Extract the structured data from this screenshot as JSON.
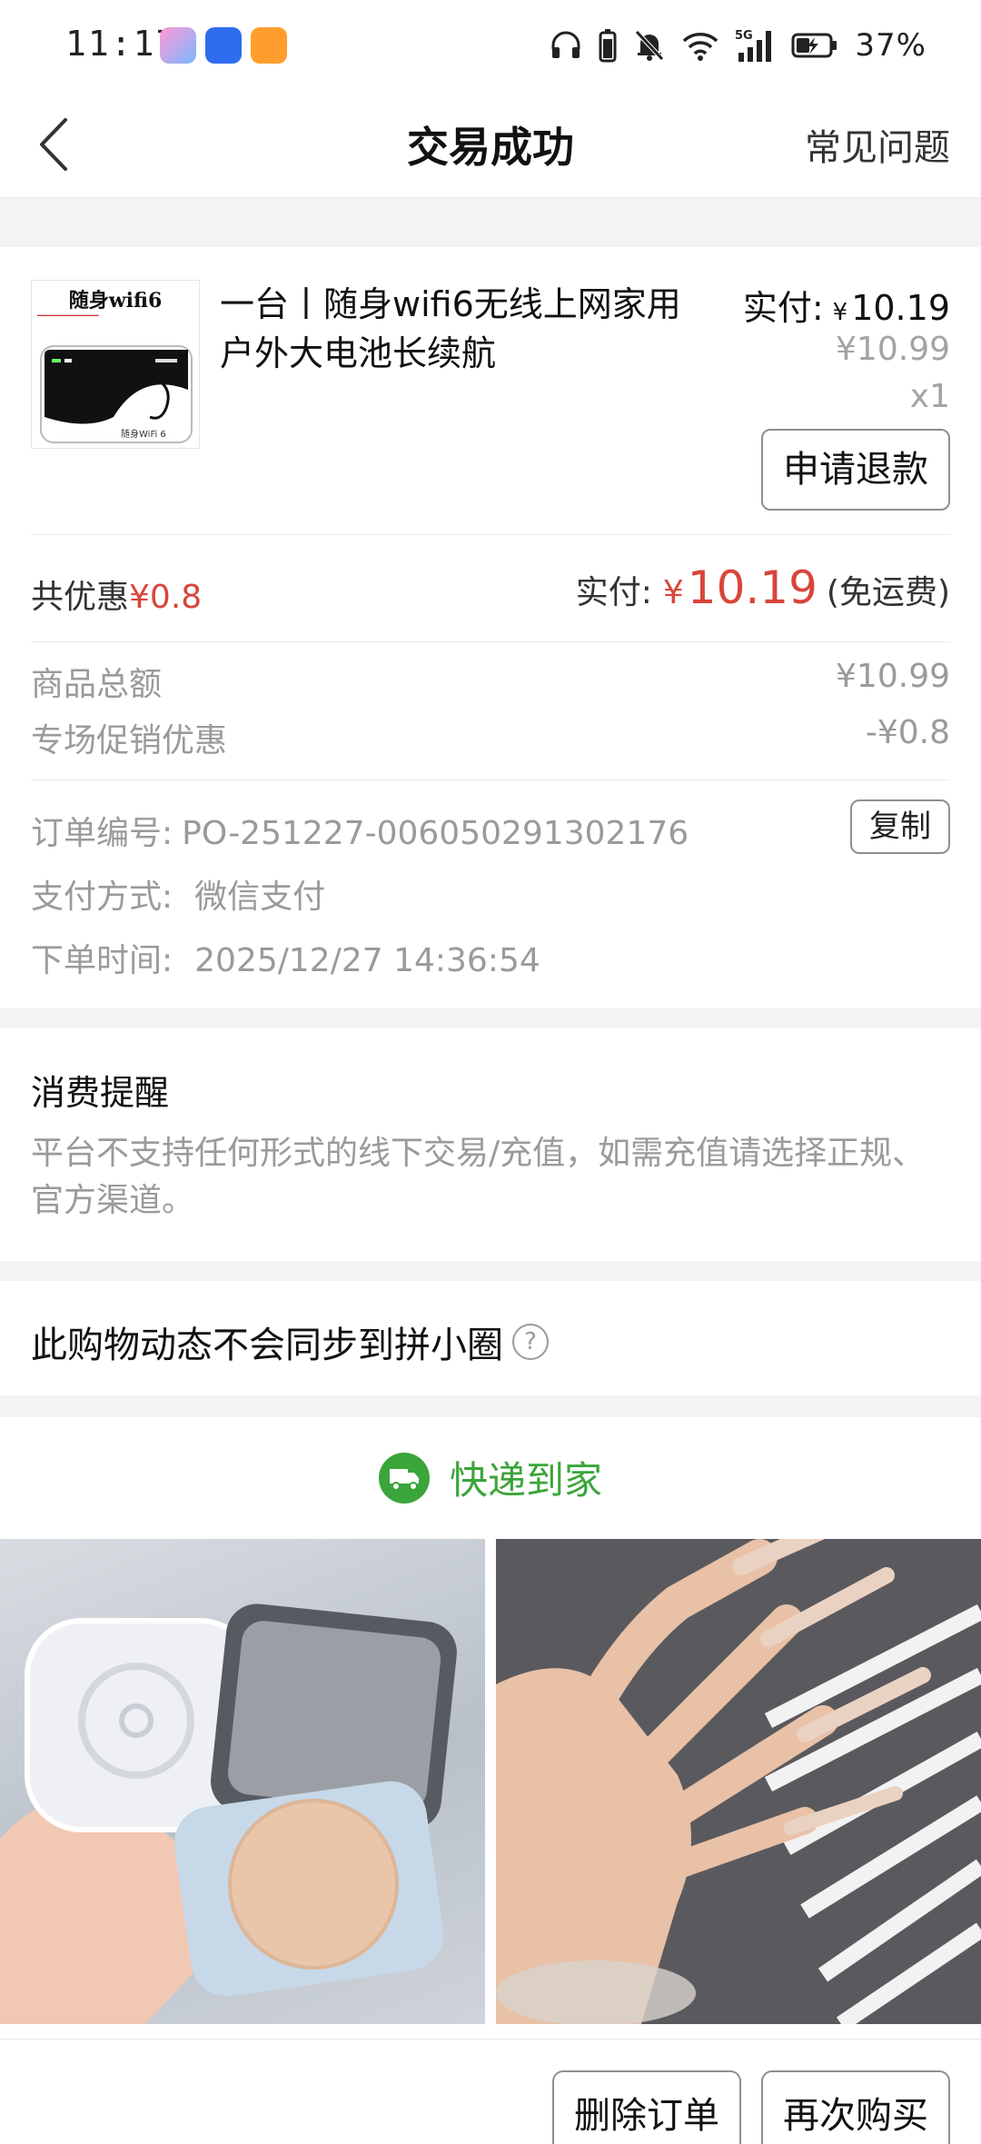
{
  "status_bar": {
    "time": "11:17",
    "battery_percent": "37%",
    "app_icons": [
      "game-center-icon",
      "app-market-icon",
      "search-app-icon"
    ],
    "indicators": [
      "headphone-icon",
      "battery-small-icon",
      "mute-bell-icon",
      "wifi-icon",
      "signal-5g-icon",
      "battery-charging-icon"
    ]
  },
  "nav": {
    "title": "交易成功",
    "faq": "常见问题"
  },
  "product": {
    "thumb_title": "随身wifi6",
    "thumb_label": "随身WiFi 6",
    "name": "一台丨随身wifi6无线上网家用户外大电池长续航",
    "paid_label": "实付:",
    "paid_yen": "¥",
    "paid_value": "10.19",
    "original_price": "¥10.99",
    "quantity": "x1",
    "refund_button": "申请退款"
  },
  "summary": {
    "discount_label": "共优惠",
    "discount_value": "¥0.8",
    "paid_label": "实付:",
    "paid_yen": "¥",
    "paid_value": "10.19",
    "shipping_note": "(免运费)"
  },
  "price_details": [
    {
      "label": "商品总额",
      "value": "¥10.99"
    },
    {
      "label": "专场促销优惠",
      "value": "-¥0.8"
    }
  ],
  "order_info": {
    "order_no_label": "订单编号:",
    "order_no": "PO-251227-006050291302176",
    "copy_button": "复制",
    "pay_method_label": "支付方式:",
    "pay_method": "微信支付",
    "order_time_label": "下单时间:",
    "order_time": "2025/12/27 14:36:54"
  },
  "reminder": {
    "title": "消费提醒",
    "text": "平台不支持任何形式的线下交易/充值，如需充值请选择正规、官方渠道。"
  },
  "sync": {
    "text": "此购物动态不会同步到拼小圈",
    "help_icon": "?"
  },
  "delivery": {
    "label": "快递到家"
  },
  "colors": {
    "accent_red": "#d9453a",
    "delivery_green": "#3aa53a",
    "muted_text": "#9a9a9a"
  },
  "bottom_actions": {
    "delete_order": "删除订单",
    "buy_again": "再次购买"
  }
}
